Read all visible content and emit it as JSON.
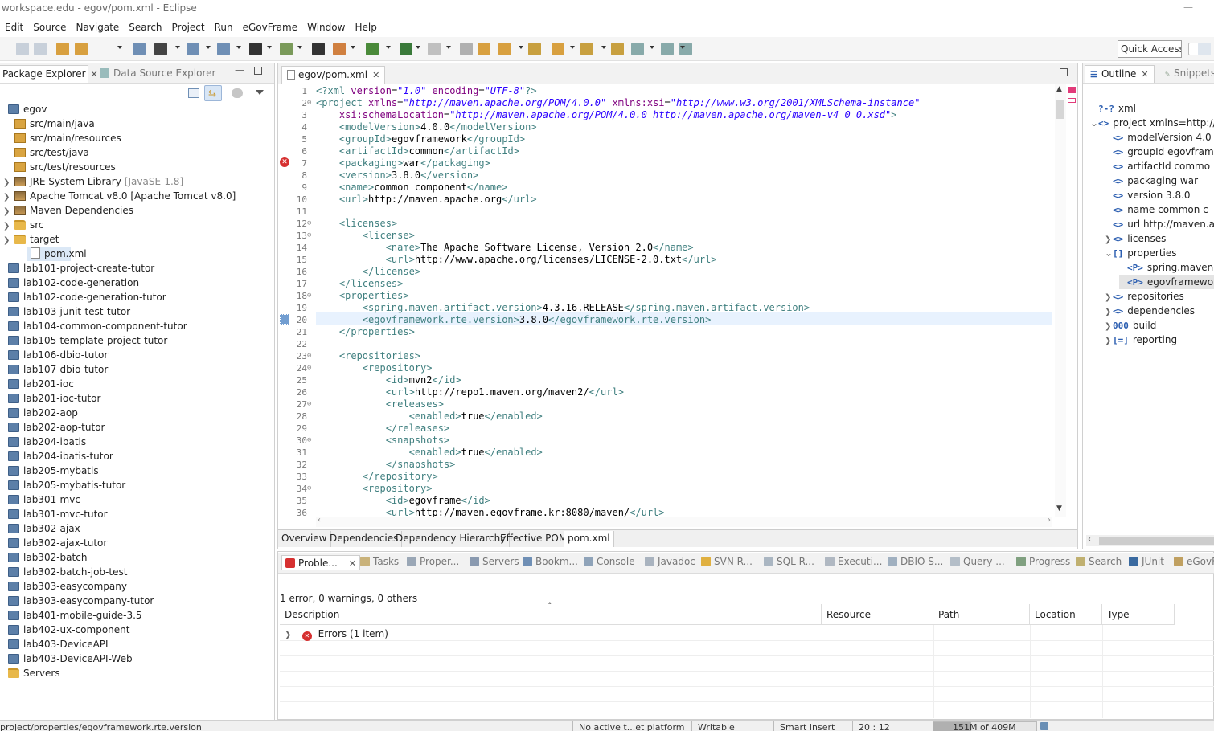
{
  "window": {
    "title": "workspace.edu - egov/pom.xml - Eclipse"
  },
  "menu": [
    "Edit",
    "Source",
    "Navigate",
    "Search",
    "Project",
    "Run",
    "eGovFrame",
    "Window",
    "Help"
  ],
  "toolbar": {
    "quick_access": "Quick Access"
  },
  "left_panel": {
    "tabs": [
      {
        "label": "Package Explorer",
        "active": true
      },
      {
        "label": "Data Source Explorer",
        "active": false
      }
    ],
    "tree": [
      {
        "label": "egov",
        "indent": 0,
        "icon": "project-icon",
        "expanded": true
      },
      {
        "label": "src/main/java",
        "indent": 1,
        "icon": "package-folder-icon"
      },
      {
        "label": "src/main/resources",
        "indent": 1,
        "icon": "package-folder-icon"
      },
      {
        "label": "src/test/java",
        "indent": 1,
        "icon": "package-folder-icon"
      },
      {
        "label": "src/test/resources",
        "indent": 1,
        "icon": "package-folder-icon"
      },
      {
        "label": "JRE System Library",
        "suffix": "[JavaSE-1.8]",
        "indent": 1,
        "icon": "library-icon",
        "collapsed": true
      },
      {
        "label": "Apache Tomcat v8.0 [Apache Tomcat v8.0]",
        "indent": 1,
        "icon": "library-icon",
        "collapsed": true
      },
      {
        "label": "Maven Dependencies",
        "indent": 1,
        "icon": "library-icon",
        "collapsed": true
      },
      {
        "label": "src",
        "indent": 1,
        "icon": "folder-icon",
        "collapsed": true
      },
      {
        "label": "target",
        "indent": 1,
        "icon": "folder-icon",
        "collapsed": true
      },
      {
        "label": "pom.xml",
        "indent": 1,
        "icon": "xml-file-icon",
        "selected": true
      },
      {
        "label": "lab101-project-create-tutor",
        "indent": 0,
        "icon": "project-icon"
      },
      {
        "label": "lab102-code-generation",
        "indent": 0,
        "icon": "project-icon"
      },
      {
        "label": "lab102-code-generation-tutor",
        "indent": 0,
        "icon": "project-icon"
      },
      {
        "label": "lab103-junit-test-tutor",
        "indent": 0,
        "icon": "project-icon"
      },
      {
        "label": "lab104-common-component-tutor",
        "indent": 0,
        "icon": "project-icon"
      },
      {
        "label": "lab105-template-project-tutor",
        "indent": 0,
        "icon": "project-icon"
      },
      {
        "label": "lab106-dbio-tutor",
        "indent": 0,
        "icon": "project-icon"
      },
      {
        "label": "lab107-dbio-tutor",
        "indent": 0,
        "icon": "project-icon"
      },
      {
        "label": "lab201-ioc",
        "indent": 0,
        "icon": "project-icon"
      },
      {
        "label": "lab201-ioc-tutor",
        "indent": 0,
        "icon": "project-icon"
      },
      {
        "label": "lab202-aop",
        "indent": 0,
        "icon": "project-icon"
      },
      {
        "label": "lab202-aop-tutor",
        "indent": 0,
        "icon": "project-icon"
      },
      {
        "label": "lab204-ibatis",
        "indent": 0,
        "icon": "project-icon"
      },
      {
        "label": "lab204-ibatis-tutor",
        "indent": 0,
        "icon": "project-icon"
      },
      {
        "label": "lab205-mybatis",
        "indent": 0,
        "icon": "project-icon"
      },
      {
        "label": "lab205-mybatis-tutor",
        "indent": 0,
        "icon": "project-icon"
      },
      {
        "label": "lab301-mvc",
        "indent": 0,
        "icon": "project-icon"
      },
      {
        "label": "lab301-mvc-tutor",
        "indent": 0,
        "icon": "project-icon"
      },
      {
        "label": "lab302-ajax",
        "indent": 0,
        "icon": "project-icon"
      },
      {
        "label": "lab302-ajax-tutor",
        "indent": 0,
        "icon": "project-icon"
      },
      {
        "label": "lab302-batch",
        "indent": 0,
        "icon": "project-icon"
      },
      {
        "label": "lab302-batch-job-test",
        "indent": 0,
        "icon": "project-icon"
      },
      {
        "label": "lab303-easycompany",
        "indent": 0,
        "icon": "project-icon"
      },
      {
        "label": "lab303-easycompany-tutor",
        "indent": 0,
        "icon": "project-icon"
      },
      {
        "label": "lab401-mobile-guide-3.5",
        "indent": 0,
        "icon": "project-icon"
      },
      {
        "label": "lab402-ux-component",
        "indent": 0,
        "icon": "project-icon"
      },
      {
        "label": "lab403-DeviceAPI",
        "indent": 0,
        "icon": "project-icon"
      },
      {
        "label": "lab403-DeviceAPI-Web",
        "indent": 0,
        "icon": "project-icon"
      },
      {
        "label": "Servers",
        "indent": 0,
        "icon": "folder-icon"
      }
    ]
  },
  "editor": {
    "tab_label": "egov/pom.xml",
    "lines": [
      [
        [
          "t",
          "<?xml "
        ],
        [
          "a",
          "version"
        ],
        [
          "x",
          "="
        ],
        [
          "v",
          "\"1.0\""
        ],
        [
          "x",
          " "
        ],
        [
          "a",
          "encoding"
        ],
        [
          "x",
          "="
        ],
        [
          "v",
          "\"UTF-8\""
        ],
        [
          "t",
          "?>"
        ]
      ],
      [
        [
          "t",
          "<project "
        ],
        [
          "a",
          "xmlns"
        ],
        [
          "x",
          "="
        ],
        [
          "v",
          "\"http://maven.apache.org/POM/4.0.0\""
        ],
        [
          "x",
          " "
        ],
        [
          "a",
          "xmlns:xsi"
        ],
        [
          "x",
          "="
        ],
        [
          "v",
          "\"http://www.w3.org/2001/XMLSchema-instance\""
        ]
      ],
      [
        [
          "x",
          "    "
        ],
        [
          "a",
          "xsi:schemaLocation"
        ],
        [
          "x",
          "="
        ],
        [
          "v",
          "\"http://maven.apache.org/POM/4.0.0 http://maven.apache.org/maven-v4_0_0.xsd\""
        ],
        [
          "t",
          ">"
        ]
      ],
      [
        [
          "x",
          "    "
        ],
        [
          "t",
          "<modelVersion>"
        ],
        [
          "x",
          "4.0.0"
        ],
        [
          "t",
          "</modelVersion>"
        ]
      ],
      [
        [
          "x",
          "    "
        ],
        [
          "t",
          "<groupId>"
        ],
        [
          "x",
          "egovframework"
        ],
        [
          "t",
          "</groupId>"
        ]
      ],
      [
        [
          "x",
          "    "
        ],
        [
          "t",
          "<artifactId>"
        ],
        [
          "x",
          "common"
        ],
        [
          "t",
          "</artifactId>"
        ]
      ],
      [
        [
          "x",
          "    "
        ],
        [
          "t",
          "<packaging>"
        ],
        [
          "x",
          "war"
        ],
        [
          "t",
          "</packaging>"
        ]
      ],
      [
        [
          "x",
          "    "
        ],
        [
          "t",
          "<version>"
        ],
        [
          "x",
          "3.8.0"
        ],
        [
          "t",
          "</version>"
        ]
      ],
      [
        [
          "x",
          "    "
        ],
        [
          "t",
          "<name>"
        ],
        [
          "x",
          "common component"
        ],
        [
          "t",
          "</name>"
        ]
      ],
      [
        [
          "x",
          "    "
        ],
        [
          "t",
          "<url>"
        ],
        [
          "x",
          "http://maven.apache.org"
        ],
        [
          "t",
          "</url>"
        ]
      ],
      [],
      [
        [
          "x",
          "    "
        ],
        [
          "t",
          "<licenses>"
        ]
      ],
      [
        [
          "x",
          "        "
        ],
        [
          "t",
          "<license>"
        ]
      ],
      [
        [
          "x",
          "            "
        ],
        [
          "t",
          "<name>"
        ],
        [
          "x",
          "The Apache Software License, Version 2.0"
        ],
        [
          "t",
          "</name>"
        ]
      ],
      [
        [
          "x",
          "            "
        ],
        [
          "t",
          "<url>"
        ],
        [
          "x",
          "http://www.apache.org/licenses/LICENSE-2.0.txt"
        ],
        [
          "t",
          "</url>"
        ]
      ],
      [
        [
          "x",
          "        "
        ],
        [
          "t",
          "</license>"
        ]
      ],
      [
        [
          "x",
          "    "
        ],
        [
          "t",
          "</licenses>"
        ]
      ],
      [
        [
          "x",
          "    "
        ],
        [
          "t",
          "<properties>"
        ]
      ],
      [
        [
          "x",
          "        "
        ],
        [
          "t",
          "<spring.maven.artifact.version>"
        ],
        [
          "x",
          "4.3.16.RELEASE"
        ],
        [
          "t",
          "</spring.maven.artifact.version>"
        ]
      ],
      [
        [
          "x",
          "        "
        ],
        [
          "t",
          "<egovframework.rte.version>"
        ],
        [
          "x",
          "3.8.0"
        ],
        [
          "t",
          "</egovframework.rte.version>"
        ]
      ],
      [
        [
          "x",
          "    "
        ],
        [
          "t",
          "</properties>"
        ]
      ],
      [],
      [
        [
          "x",
          "    "
        ],
        [
          "t",
          "<repositories>"
        ]
      ],
      [
        [
          "x",
          "        "
        ],
        [
          "t",
          "<repository>"
        ]
      ],
      [
        [
          "x",
          "            "
        ],
        [
          "t",
          "<id>"
        ],
        [
          "x",
          "mvn2"
        ],
        [
          "t",
          "</id>"
        ]
      ],
      [
        [
          "x",
          "            "
        ],
        [
          "t",
          "<url>"
        ],
        [
          "x",
          "http://repo1.maven.org/maven2/"
        ],
        [
          "t",
          "</url>"
        ]
      ],
      [
        [
          "x",
          "            "
        ],
        [
          "t",
          "<releases>"
        ]
      ],
      [
        [
          "x",
          "                "
        ],
        [
          "t",
          "<enabled>"
        ],
        [
          "x",
          "true"
        ],
        [
          "t",
          "</enabled>"
        ]
      ],
      [
        [
          "x",
          "            "
        ],
        [
          "t",
          "</releases>"
        ]
      ],
      [
        [
          "x",
          "            "
        ],
        [
          "t",
          "<snapshots>"
        ]
      ],
      [
        [
          "x",
          "                "
        ],
        [
          "t",
          "<enabled>"
        ],
        [
          "x",
          "true"
        ],
        [
          "t",
          "</enabled>"
        ]
      ],
      [
        [
          "x",
          "            "
        ],
        [
          "t",
          "</snapshots>"
        ]
      ],
      [
        [
          "x",
          "        "
        ],
        [
          "t",
          "</repository>"
        ]
      ],
      [
        [
          "x",
          "        "
        ],
        [
          "t",
          "<repository>"
        ]
      ],
      [
        [
          "x",
          "            "
        ],
        [
          "t",
          "<id>"
        ],
        [
          "x",
          "egovframe"
        ],
        [
          "t",
          "</id>"
        ]
      ],
      [
        [
          "x",
          "            "
        ],
        [
          "t",
          "<url>"
        ],
        [
          "x",
          "http://maven.egovframe.kr:8080/maven/"
        ],
        [
          "t",
          "</url>"
        ]
      ]
    ],
    "line_numbers": [
      "1",
      "2",
      "3",
      "4",
      "5",
      "6",
      "7",
      "8",
      "9",
      "10",
      "11",
      "12",
      "13",
      "14",
      "15",
      "16",
      "17",
      "18",
      "19",
      "20",
      "21",
      "22",
      "23",
      "24",
      "25",
      "26",
      "27",
      "28",
      "29",
      "30",
      "31",
      "32",
      "33",
      "34",
      "35",
      "36"
    ],
    "fold_marks": [
      2,
      12,
      13,
      18,
      23,
      24,
      27,
      30,
      34
    ],
    "error_line": 7,
    "current_line": 20,
    "bottom_tabs": [
      "Overview",
      "Dependencies",
      "Dependency Hierarchy",
      "Effective POM",
      "pom.xml"
    ]
  },
  "outline": {
    "tabs": [
      {
        "label": "Outline",
        "active": true
      },
      {
        "label": "Snippets",
        "active": false
      }
    ],
    "rows": [
      {
        "icon": "?-?",
        "label": "xml",
        "indent": 0
      },
      {
        "icon": "<>",
        "label": "project xmlns=http://",
        "indent": 0,
        "expanded": true
      },
      {
        "icon": "<>",
        "label": "modelVersion  4.0",
        "indent": 1
      },
      {
        "icon": "<>",
        "label": "groupId  egovfram",
        "indent": 1
      },
      {
        "icon": "<>",
        "label": "artifactId  commo",
        "indent": 1
      },
      {
        "icon": "<>",
        "label": "packaging  war",
        "indent": 1
      },
      {
        "icon": "<>",
        "label": "version  3.8.0",
        "indent": 1
      },
      {
        "icon": "<>",
        "label": "name  common c",
        "indent": 1
      },
      {
        "icon": "<>",
        "label": "url  http://maven.a",
        "indent": 1
      },
      {
        "icon": "<>",
        "label": "licenses",
        "indent": 1,
        "collapsed": true
      },
      {
        "icon": "[]",
        "label": "properties",
        "indent": 1,
        "expanded": true
      },
      {
        "icon": "<P>",
        "label": "spring.maven.a",
        "indent": 2
      },
      {
        "icon": "<P>",
        "label": "egovframework",
        "indent": 2,
        "selected": true
      },
      {
        "icon": "<>",
        "label": "repositories",
        "indent": 1,
        "collapsed": true
      },
      {
        "icon": "<>",
        "label": "dependencies",
        "indent": 1,
        "collapsed": true
      },
      {
        "icon": "000",
        "label": "build",
        "indent": 1,
        "collapsed": true
      },
      {
        "icon": "[=]",
        "label": "reporting",
        "indent": 1,
        "collapsed": true
      }
    ]
  },
  "problems": {
    "tabs": [
      "Proble...",
      "Tasks",
      "Proper...",
      "Servers",
      "Bookm...",
      "Console",
      "Javadoc",
      "SVN R...",
      "SQL R...",
      "Executi...",
      "DBIO S...",
      "Query ...",
      "Progress",
      "Search",
      "JUnit",
      "eGovF"
    ],
    "summary": "1 error, 0 warnings, 0 others",
    "columns": [
      "Description",
      "Resource",
      "Path",
      "Location",
      "Type"
    ],
    "rows": [
      {
        "label": "Errors (1 item)"
      }
    ]
  },
  "status": {
    "path": "project/properties/egovframework.rte.version",
    "target_platform": "No active t...et platform",
    "writable": "Writable",
    "insert_mode": "Smart Insert",
    "position": "20 : 12",
    "memory": "151M of 409M",
    "memory_used_fraction": 0.37
  }
}
